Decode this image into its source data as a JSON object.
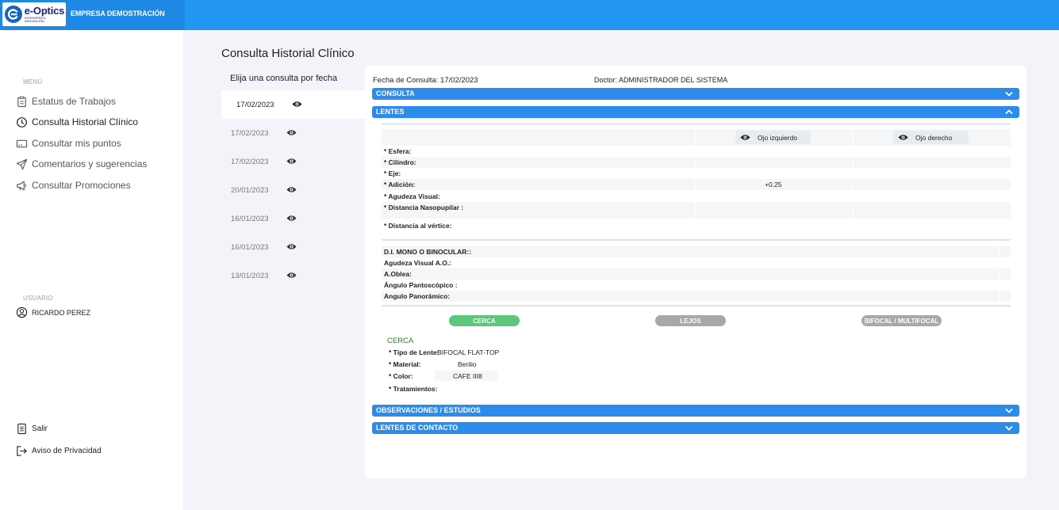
{
  "header": {
    "logo_name": "e-Optics",
    "logo_tagline": "INGENIERÍA & INNOVACIÓN",
    "company": "EMPRESA DEMOSTRACIÓN",
    "colors": {
      "bar": "#2196f3",
      "accent": "#2d8ceb"
    }
  },
  "sidebar": {
    "menu_label": "MENÚ",
    "items": [
      {
        "label": "Estatus de Trabajos",
        "icon": "clipboard-icon"
      },
      {
        "label": "Consulta Historial Clínico",
        "icon": "clock-icon",
        "active": true
      },
      {
        "label": "Consultar mis puntos",
        "icon": "card-icon"
      },
      {
        "label": "Comentarios y sugerencias",
        "icon": "send-icon"
      },
      {
        "label": "Consultar Promociones",
        "icon": "megaphone-icon"
      }
    ],
    "user_label": "USUARIO",
    "user_name": "RICARDO PEREZ",
    "logout": "Salir",
    "privacy": "Aviso de Privacidad"
  },
  "main": {
    "title": "Consulta Historial Clínico",
    "list_header": "Elija una consulta por fecha",
    "dates": [
      "17/02/2023",
      "17/02/2023",
      "17/02/2023",
      "20/01/2023",
      "16/01/2023",
      "16/01/2023",
      "13/01/2023"
    ]
  },
  "detail": {
    "fecha": "Fecha de Consulta: 17/02/2023",
    "doctor": "Doctor: ADMINISTRADOR DEL SISTEMA",
    "sections": {
      "consulta": "CONSULTA",
      "lentes": "LENTES",
      "observaciones": "OBSERVACIONES / ESTUDIOS",
      "contacto": "LENTES DE CONTACTO"
    },
    "eye_left": "Ojo izquierdo",
    "eye_right": "Ojo derecho",
    "rows": {
      "esfera": "* Esfera:",
      "cilindro": "* Cilindro:",
      "eje": "* Eje:",
      "adicion": "* Adición:",
      "agudeza": "* Agudeza Visual:",
      "nasopupilar": "* Distancia Nasopupilar :",
      "vertice": "* Distancia al vértice:"
    },
    "adicion_left": "+0.25",
    "rows2": {
      "di": "D.I. MONO O BINOCULAR::",
      "agudeza_ao": "Agudeza Visual A.O.:",
      "oblea": "A.Oblea:",
      "pantoscopico": "Ángulo Pantoscópico :",
      "panoramico": "Angulo Panorámico:"
    },
    "tabs": {
      "cerca": "CERCA",
      "lejos": "LEJOS",
      "bifocal": "BIFOCAL / MULTIFOCAL",
      "colors": {
        "cerca": "#5cc77a",
        "lejos": "#a8a8a8",
        "bifocal": "#a8a8a8"
      }
    },
    "cerca": {
      "title": "CERCA",
      "tipo_label": "* Tipo de Lente:",
      "tipo_value": "BIFOCAL FLAT-TOP",
      "material_label": "* Material:",
      "material_value": "Berilio",
      "color_label": "* Color:",
      "color_value": "CAFE III8",
      "tratamientos_label": "* Tratamientos:"
    }
  }
}
